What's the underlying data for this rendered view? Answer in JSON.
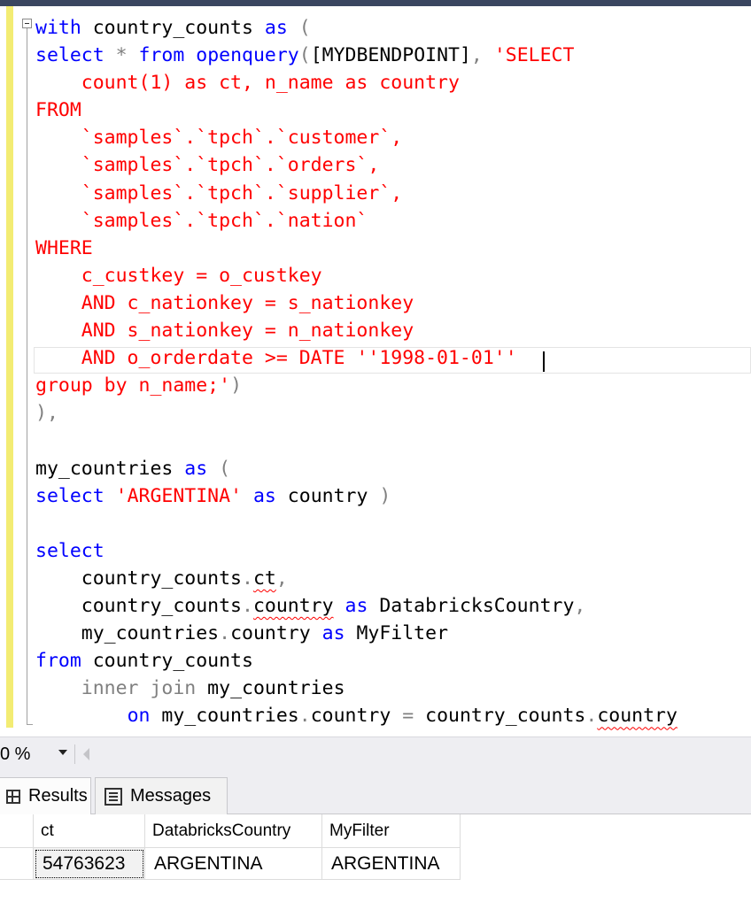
{
  "editor": {
    "lines": [
      [
        {
          "t": "with",
          "c": "kw"
        },
        {
          "t": " country_counts "
        },
        {
          "t": "as",
          "c": "kw"
        },
        {
          "t": " (",
          "c": "gr"
        }
      ],
      [
        {
          "t": "select",
          "c": "kw"
        },
        {
          "t": " * ",
          "c": "gr"
        },
        {
          "t": "from",
          "c": "kw"
        },
        {
          "t": " "
        },
        {
          "t": "openquery",
          "c": "kw"
        },
        {
          "t": "(",
          "c": "gr"
        },
        {
          "t": "[MYDBENDPOINT]"
        },
        {
          "t": ", ",
          "c": "gr"
        },
        {
          "t": "'SELECT",
          "c": "str"
        }
      ],
      [
        {
          "t": "    count(1) as ct, n_name as country",
          "c": "str"
        }
      ],
      [
        {
          "t": "FROM",
          "c": "str"
        }
      ],
      [
        {
          "t": "    `samples`.`tpch`.`customer`,",
          "c": "str"
        }
      ],
      [
        {
          "t": "    `samples`.`tpch`.`orders`,",
          "c": "str"
        }
      ],
      [
        {
          "t": "    `samples`.`tpch`.`supplier`,",
          "c": "str"
        }
      ],
      [
        {
          "t": "    `samples`.`tpch`.`nation`",
          "c": "str"
        }
      ],
      [
        {
          "t": "WHERE",
          "c": "str"
        }
      ],
      [
        {
          "t": "    c_custkey = o_custkey",
          "c": "str"
        }
      ],
      [
        {
          "t": "    AND c_nationkey = s_nationkey",
          "c": "str"
        }
      ],
      [
        {
          "t": "    AND s_nationkey = n_nationkey",
          "c": "str"
        }
      ],
      [
        {
          "t": "    AND o_orderdate >= DATE ''1998-01-01''",
          "c": "str"
        }
      ],
      [
        {
          "t": "group by n_name;'",
          "c": "str"
        },
        {
          "t": ")",
          "c": "gr"
        }
      ],
      [
        {
          "t": "),",
          "c": "gr"
        }
      ],
      [
        {
          "t": ""
        }
      ],
      [
        {
          "t": "my_countries "
        },
        {
          "t": "as",
          "c": "kw"
        },
        {
          "t": " (",
          "c": "gr"
        }
      ],
      [
        {
          "t": "select",
          "c": "kw"
        },
        {
          "t": " "
        },
        {
          "t": "'ARGENTINA'",
          "c": "str"
        },
        {
          "t": " "
        },
        {
          "t": "as",
          "c": "kw"
        },
        {
          "t": " country "
        },
        {
          "t": ")",
          "c": "gr"
        }
      ],
      [
        {
          "t": ""
        }
      ],
      [
        {
          "t": "select",
          "c": "kw"
        }
      ],
      [
        {
          "t": "    country_counts"
        },
        {
          "t": ".",
          "c": "gr"
        },
        {
          "t": "ct",
          "c": "squig"
        },
        {
          "t": ",",
          "c": "gr"
        }
      ],
      [
        {
          "t": "    country_counts"
        },
        {
          "t": ".",
          "c": "gr"
        },
        {
          "t": "country",
          "c": "squig"
        },
        {
          "t": " "
        },
        {
          "t": "as",
          "c": "kw"
        },
        {
          "t": " DatabricksCountry"
        },
        {
          "t": ",",
          "c": "gr"
        }
      ],
      [
        {
          "t": "    my_countries"
        },
        {
          "t": ".",
          "c": "gr"
        },
        {
          "t": "country "
        },
        {
          "t": "as",
          "c": "kw"
        },
        {
          "t": " MyFilter"
        }
      ],
      [
        {
          "t": "from",
          "c": "kw"
        },
        {
          "t": " country_counts"
        }
      ],
      [
        {
          "t": "    "
        },
        {
          "t": "inner join",
          "c": "gr"
        },
        {
          "t": " my_countries"
        }
      ],
      [
        {
          "t": "        "
        },
        {
          "t": "on",
          "c": "kw"
        },
        {
          "t": " my_countries"
        },
        {
          "t": ".",
          "c": "gr"
        },
        {
          "t": "country "
        },
        {
          "t": "=",
          "c": "gr"
        },
        {
          "t": " country_counts"
        },
        {
          "t": ".",
          "c": "gr"
        },
        {
          "t": "country",
          "c": "squig"
        }
      ]
    ]
  },
  "zoom": {
    "value": "0 %"
  },
  "results": {
    "tabs": {
      "results_label": "Results",
      "messages_label": "Messages"
    },
    "columns": [
      "ct",
      "DatabricksCountry",
      "MyFilter"
    ],
    "rows": [
      [
        "54763623",
        "ARGENTINA",
        "ARGENTINA"
      ]
    ]
  }
}
